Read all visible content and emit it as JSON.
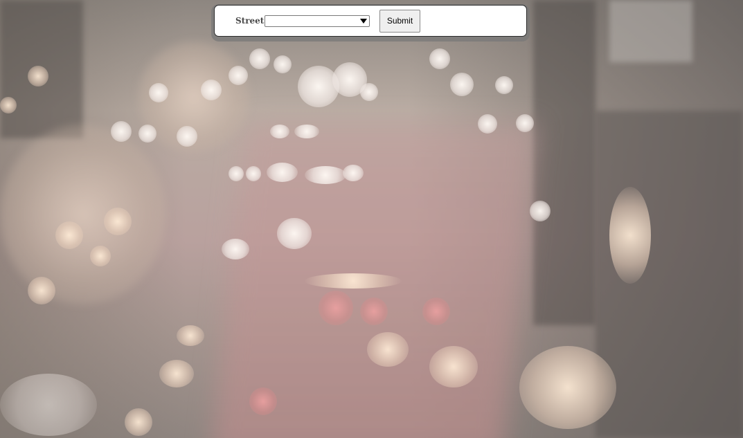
{
  "form": {
    "street_label": "Street:",
    "street_select": {
      "selected_value": "",
      "icon": "dropdown-arrow-icon"
    },
    "submit_label": "Submit"
  },
  "background": {
    "description_kind": "blurred-city-street-photo"
  }
}
